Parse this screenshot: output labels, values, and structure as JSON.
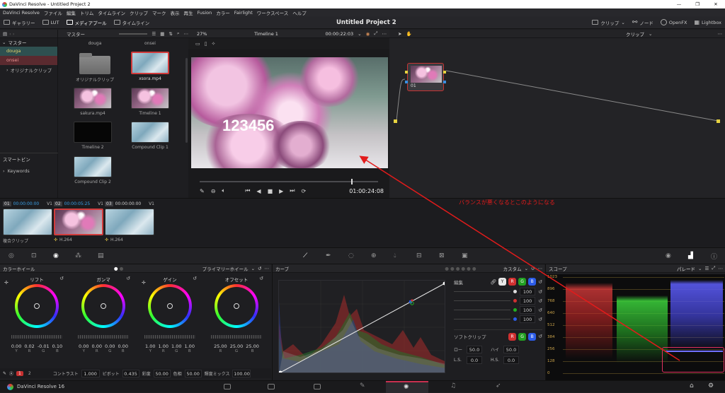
{
  "window": {
    "title": "DaVinci Resolve - Untitled Project 2",
    "controls": [
      "—",
      "❐",
      "✕"
    ]
  },
  "menu": [
    "DaVinci Resolve",
    "ファイル",
    "編集",
    "トリム",
    "タイムライン",
    "クリップ",
    "マーク",
    "表示",
    "再生",
    "Fusion",
    "カラー",
    "Fairlight",
    "ワークスペース",
    "ヘルプ"
  ],
  "toolbar": {
    "gallery": "ギャラリー",
    "lut": "LUT",
    "media_pool": "メディアプール",
    "timeline": "タイムライン",
    "project_title": "Untitled Project 2",
    "clip": "クリップ",
    "node": "ノード",
    "openfx": "OpenFX",
    "lightbox": "Lightbox"
  },
  "media_pool": {
    "master_label": "マスター",
    "bins": [
      "douga",
      "onsei"
    ],
    "smart_bin_folder": "オリジナルクリップ",
    "smart_bins_label": "スマートビン",
    "keywords": "Keywords",
    "col_headers": [
      "douga",
      "onsei"
    ],
    "items": [
      "オリジナルクリップ",
      "xsora.mp4",
      "sakura.mp4",
      "Timeline 1",
      "Timeline 2",
      "Compound Clip 1",
      "Compound Clip 2"
    ]
  },
  "viewer": {
    "zoom": "27%",
    "timeline_name": "Timeline 1",
    "timecode_top": "00:00:22:03",
    "overlay_text": "123456",
    "timecode_bottom": "01:00:24:08"
  },
  "node_editor": {
    "header_label": "クリップ",
    "node_label": "01"
  },
  "annotation": {
    "text": "バランスが悪くなるとこのようになる",
    "color": "#e21b1b"
  },
  "clips": [
    {
      "num": "01",
      "tc": "00:00:00:00",
      "track": "V1",
      "name": "複合クリップ",
      "codec": ""
    },
    {
      "num": "02",
      "tc": "00:00:05:25",
      "track": "V1",
      "name": "",
      "codec": "H.264"
    },
    {
      "num": "03",
      "tc": "00:00:00:00",
      "track": "V1",
      "name": "",
      "codec": "H.264"
    }
  ],
  "color_wheels": {
    "title": "カラーホイール",
    "mode": "プライマリーホイール",
    "wheels": [
      {
        "name": "リフト",
        "values": [
          "0.00",
          "0.02",
          "-0.01",
          "0.10"
        ],
        "channels": [
          "Y",
          "R",
          "G",
          "B"
        ]
      },
      {
        "name": "ガンマ",
        "values": [
          "0.00",
          "0.00",
          "0.00",
          "0.00"
        ],
        "channels": [
          "Y",
          "R",
          "G",
          "B"
        ]
      },
      {
        "name": "ゲイン",
        "values": [
          "1.00",
          "1.00",
          "1.00",
          "1.00"
        ],
        "channels": [
          "Y",
          "R",
          "G",
          "B"
        ]
      },
      {
        "name": "オフセット",
        "values": [
          "25.00",
          "25.00",
          "25.00"
        ],
        "channels": [
          "R",
          "G",
          "B"
        ]
      }
    ],
    "footer": {
      "page1": "1",
      "page2": "2",
      "contrast_label": "コントラスト",
      "contrast": "1.000",
      "pivot_label": "ピボット",
      "pivot": "0.435",
      "sat_label": "彩度",
      "sat": "50.00",
      "hue_label": "色相",
      "hue": "50.00",
      "lummix_label": "輝度ミックス",
      "lummix": "100.00"
    }
  },
  "curves": {
    "title": "カーブ",
    "mode": "カスタム",
    "edit_label": "編集",
    "channels": [
      {
        "chip": "Y",
        "value": "100"
      },
      {
        "chip": "R",
        "value": "100"
      },
      {
        "chip": "G",
        "value": "100"
      },
      {
        "chip": "B",
        "value": "100"
      }
    ],
    "soft_clip_label": "ソフトクリップ",
    "low_label": "ロー",
    "low": "50.0",
    "high_label": "ハイ",
    "high": "50.0",
    "ls_label": "L.S.",
    "ls": "0.0",
    "hs_label": "H.S.",
    "hs": "0.0"
  },
  "scope": {
    "title": "スコープ",
    "mode": "パレード",
    "ticks": [
      "1023",
      "896",
      "768",
      "640",
      "512",
      "384",
      "256",
      "128",
      "0"
    ]
  },
  "status": {
    "app": "DaVinci Resolve 16"
  },
  "colors": {
    "accent_red": "#e02020",
    "timecode_blue": "#3aa0e8",
    "bin_selected": "#2e5050",
    "bin_onsei": "#5a2a2f"
  }
}
